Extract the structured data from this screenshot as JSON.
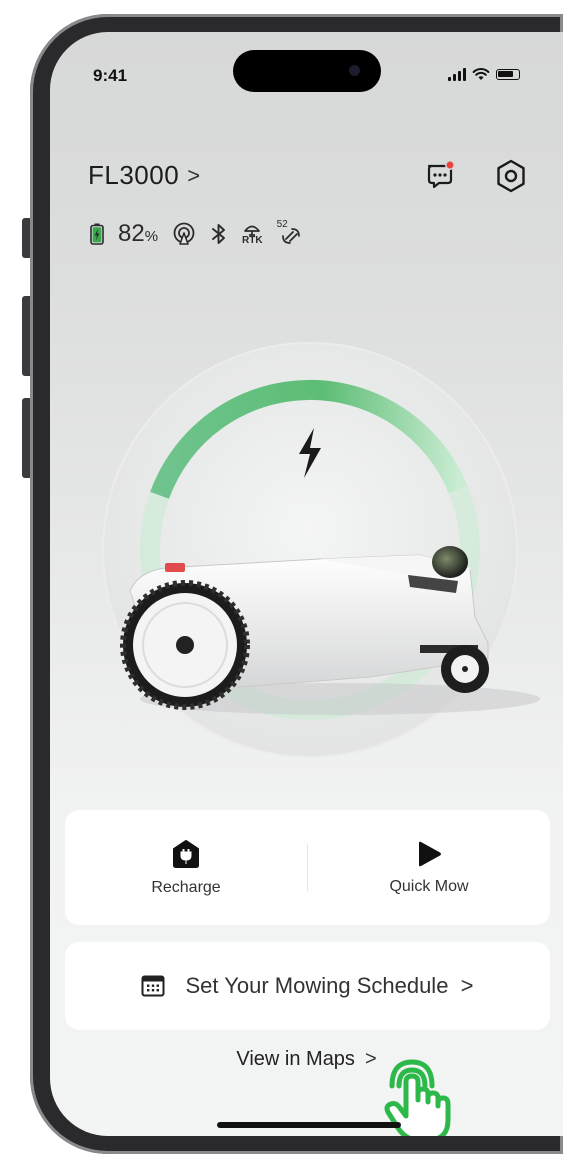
{
  "status_bar": {
    "time": "9:41"
  },
  "header": {
    "device_name": "FL3000",
    "chevron": ">",
    "message_icon": "chat-bubble-icon",
    "settings_icon": "hexagon-settings-icon",
    "notification_color": "#e8453c"
  },
  "stats": {
    "battery_value": "82",
    "battery_unit": "%",
    "battery_level": 0.82,
    "icons": [
      "battery-charging-icon",
      "signal-hotspot-icon",
      "bluetooth-icon",
      "rtk-icon",
      "satellite-icon"
    ],
    "rtk_label": "RTK",
    "satellite_count": "52"
  },
  "gauge": {
    "level": 0.82,
    "accent_color": "#63c27f",
    "charging_icon": "lightning-icon"
  },
  "actions": [
    {
      "label": "Recharge",
      "icon": "home-plug-icon"
    },
    {
      "label": "Quick Mow",
      "icon": "play-icon"
    }
  ],
  "schedule": {
    "label": "Set Your Mowing Schedule",
    "chevron": ">",
    "icon": "calendar-icon"
  },
  "maps": {
    "label": "View in Maps",
    "chevron": ">"
  },
  "pointer_color": "#2db84a"
}
